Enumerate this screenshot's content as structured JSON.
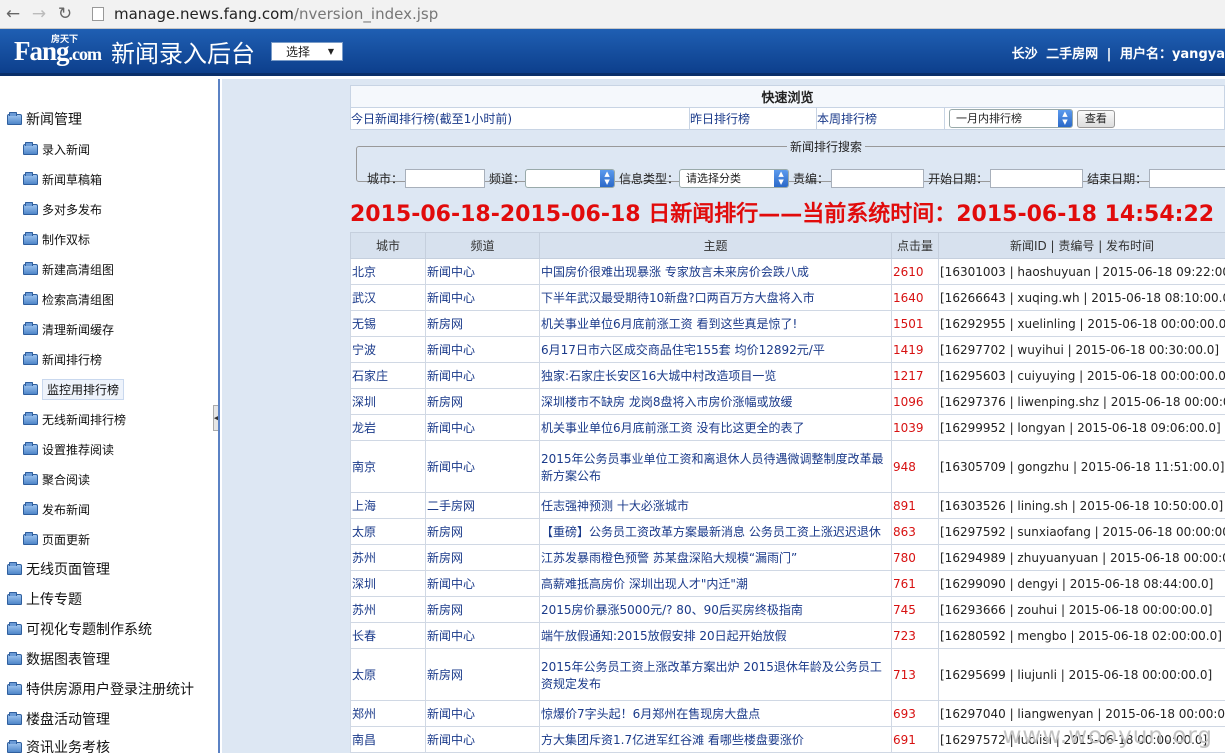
{
  "browser": {
    "url_host": "manage.news.fang.com",
    "url_path": "/nversion_index.jsp"
  },
  "header": {
    "logo_main": "Fang",
    "logo_dot": ".com",
    "logo_sup": "房天下",
    "title": "新闻录入后台",
    "select_label": "选择",
    "city": "长沙",
    "site": "二手房网",
    "separator": "|",
    "user_label": "用户名：yangya"
  },
  "sidebar": {
    "groups_top": {
      "label": "新闻管理"
    },
    "items": [
      {
        "label": "录入新闻"
      },
      {
        "label": "新闻草稿箱"
      },
      {
        "label": "多对多发布"
      },
      {
        "label": "制作双标"
      },
      {
        "label": "新建高清组图"
      },
      {
        "label": "检索高清组图"
      },
      {
        "label": "清理新闻缓存"
      },
      {
        "label": "新闻排行榜"
      },
      {
        "label": "监控用排行榜"
      },
      {
        "label": "无线新闻排行榜"
      },
      {
        "label": "设置推荐阅读"
      },
      {
        "label": "聚合阅读"
      },
      {
        "label": "发布新闻"
      },
      {
        "label": "页面更新"
      }
    ],
    "groups": [
      {
        "label": "无线页面管理"
      },
      {
        "label": "上传专题"
      },
      {
        "label": "可视化专题制作系统"
      },
      {
        "label": "数据图表管理"
      },
      {
        "label": "特供房源用户登录注册统计"
      },
      {
        "label": "楼盘活动管理"
      },
      {
        "label": "资讯业务考核"
      }
    ]
  },
  "quick": {
    "title": "快速浏览",
    "today": "今日新闻排行榜(截至1小时前)",
    "yesterday": "昨日排行榜",
    "week": "本周排行榜",
    "month_select": "一月内排行榜",
    "view_button": "查看"
  },
  "search": {
    "legend": "新闻排行搜索",
    "city_label": "城市：",
    "channel_label": "频道：",
    "info_type_label": "信息类型：",
    "info_type_select": "请选择分类",
    "editor_label": "责编：",
    "start_label": "开始日期：",
    "end_label": "结束日期："
  },
  "headline": "2015-06-18-2015-06-18 日新闻排行——当前系统时间：2015-06-18 14:54:22",
  "table": {
    "columns": [
      "城市",
      "频道",
      "主题",
      "点击量",
      "新闻ID | 责编号 | 发布时间"
    ],
    "rows": [
      {
        "city": "北京",
        "channel": "新闻中心",
        "subject": "中国房价很难出现暴涨 专家放言未来房价会跌八成",
        "clicks": "2610",
        "meta": "[16301003 | haoshuyuan | 2015-06-18 09:22:00.0]"
      },
      {
        "city": "武汉",
        "channel": "新闻中心",
        "subject": "下半年武汉最受期待10新盘?口两百万方大盘将入市",
        "clicks": "1640",
        "meta": "[16266643 | xuqing.wh | 2015-06-18 08:10:00.0]"
      },
      {
        "city": "无锡",
        "channel": "新房网",
        "subject": "机关事业单位6月底前涨工资 看到这些真是惊了!",
        "clicks": "1501",
        "meta": "[16292955 | xuelinling | 2015-06-18 00:00:00.0]"
      },
      {
        "city": "宁波",
        "channel": "新闻中心",
        "subject": "6月17日市六区成交商品住宅155套 均价12892元/平",
        "clicks": "1419",
        "meta": "[16297702 | wuyihui | 2015-06-18 00:30:00.0]"
      },
      {
        "city": "石家庄",
        "channel": "新闻中心",
        "subject": "独家:石家庄长安区16大城中村改造项目一览",
        "clicks": "1217",
        "meta": "[16295603 | cuiyuying | 2015-06-18 00:00:00.0]"
      },
      {
        "city": "深圳",
        "channel": "新房网",
        "subject": "深圳楼市不缺房 龙岗8盘将入市房价涨幅或放缓",
        "clicks": "1096",
        "meta": "[16297376 | liwenping.shz | 2015-06-18 00:00:00.0]"
      },
      {
        "city": "龙岩",
        "channel": "新闻中心",
        "subject": "机关事业单位6月底前涨工资 没有比这更全的表了",
        "clicks": "1039",
        "meta": "[16299952 | longyan | 2015-06-18 09:06:00.0]"
      },
      {
        "city": "南京",
        "channel": "新闻中心",
        "subject": "2015年公务员事业单位工资和离退休人员待遇微调整制度改革最新方案公布",
        "clicks": "948",
        "meta": "[16305709 | gongzhu | 2015-06-18 11:51:00.0]",
        "tall": true
      },
      {
        "city": "上海",
        "channel": "二手房网",
        "subject": "任志强神预测 十大必涨城市",
        "clicks": "891",
        "meta": "[16303526 | lining.sh | 2015-06-18 10:50:00.0]"
      },
      {
        "city": "太原",
        "channel": "新房网",
        "subject": "【重磅】公务员工资改革方案最新消息 公务员工资上涨迟迟退休",
        "clicks": "863",
        "meta": "[16297592 | sunxiaofang | 2015-06-18 00:00:00.0]"
      },
      {
        "city": "苏州",
        "channel": "新房网",
        "subject": "江苏发暴雨橙色预警 苏某盘深陷大规模“漏雨门”",
        "clicks": "780",
        "meta": "[16294989 | zhuyuanyuan | 2015-06-18 00:00:00.0]"
      },
      {
        "city": "深圳",
        "channel": "新闻中心",
        "subject": "高薪难抵高房价 深圳出现人才\"内迁\"潮",
        "clicks": "761",
        "meta": "[16299090 | dengyi | 2015-06-18 08:44:00.0]"
      },
      {
        "city": "苏州",
        "channel": "新房网",
        "subject": "2015房价暴涨5000元/? 80、90后买房终极指南",
        "clicks": "745",
        "meta": "[16293666 | zouhui | 2015-06-18 00:00:00.0]"
      },
      {
        "city": "长春",
        "channel": "新闻中心",
        "subject": "端午放假通知:2015放假安排 20日起开始放假",
        "clicks": "723",
        "meta": "[16280592 | mengbo | 2015-06-18 02:00:00.0]"
      },
      {
        "city": "太原",
        "channel": "新房网",
        "subject": "2015年公务员工资上涨改革方案出炉 2015退休年龄及公务员工资规定发布",
        "clicks": "713",
        "meta": "[16295699 | liujunli | 2015-06-18 00:00:00.0]",
        "tall": true
      },
      {
        "city": "郑州",
        "channel": "新闻中心",
        "subject": "惊爆价7字头起！6月郑州在售现房大盘点",
        "clicks": "693",
        "meta": "[16297040 | liangwenyan | 2015-06-18 00:00:00.0]"
      },
      {
        "city": "南昌",
        "channel": "新闻中心",
        "subject": "方大集团斥资1.7亿进军红谷滩 看哪些楼盘要涨价",
        "clicks": "691",
        "meta": "[16297572 | luolisi | 2015-06-18 00:00:00.0]"
      }
    ]
  },
  "watermark": "www.wooyun.org"
}
